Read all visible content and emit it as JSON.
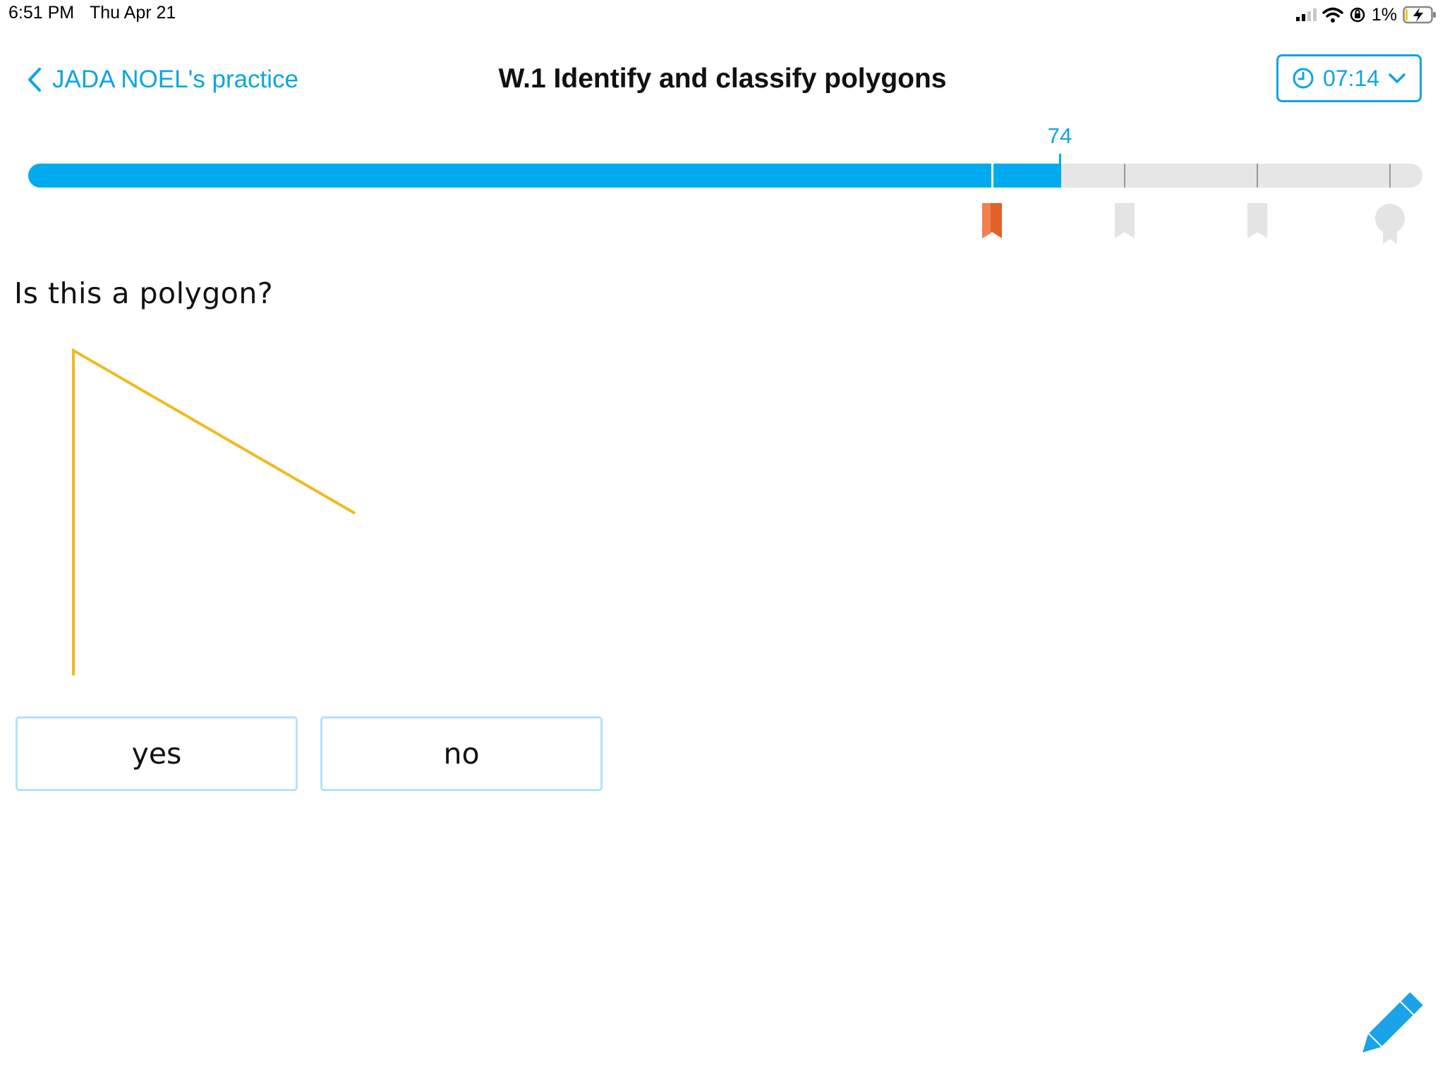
{
  "status_bar": {
    "time": "6:51 PM",
    "date": "Thu Apr 21",
    "battery": "1%",
    "icons": [
      "cellular-signal-icon",
      "wifi-icon",
      "orientation-lock-icon",
      "battery-charging-icon"
    ]
  },
  "header": {
    "back_label": "JADA NOEL's practice",
    "title": "W.1 Identify and classify polygons",
    "timer": "07:14"
  },
  "progress": {
    "score": "74",
    "percent": 74,
    "milestones": [
      {
        "name": "bookmark-earned-icon",
        "state": "earned"
      },
      {
        "name": "bookmark-icon",
        "state": "pending"
      },
      {
        "name": "bookmark-icon",
        "state": "pending"
      },
      {
        "name": "medal-icon",
        "state": "pending"
      }
    ]
  },
  "question": {
    "prompt": "Is this a polygon?"
  },
  "answers": {
    "yes": "yes",
    "no": "no"
  },
  "colors": {
    "accent": "#00aaef",
    "link": "#0ea5e0",
    "figure_stroke": "#f0bb1f",
    "earned_bookmark": "#e0622a",
    "track": "#e6e6e6",
    "answer_border": "#b3e3f8"
  }
}
